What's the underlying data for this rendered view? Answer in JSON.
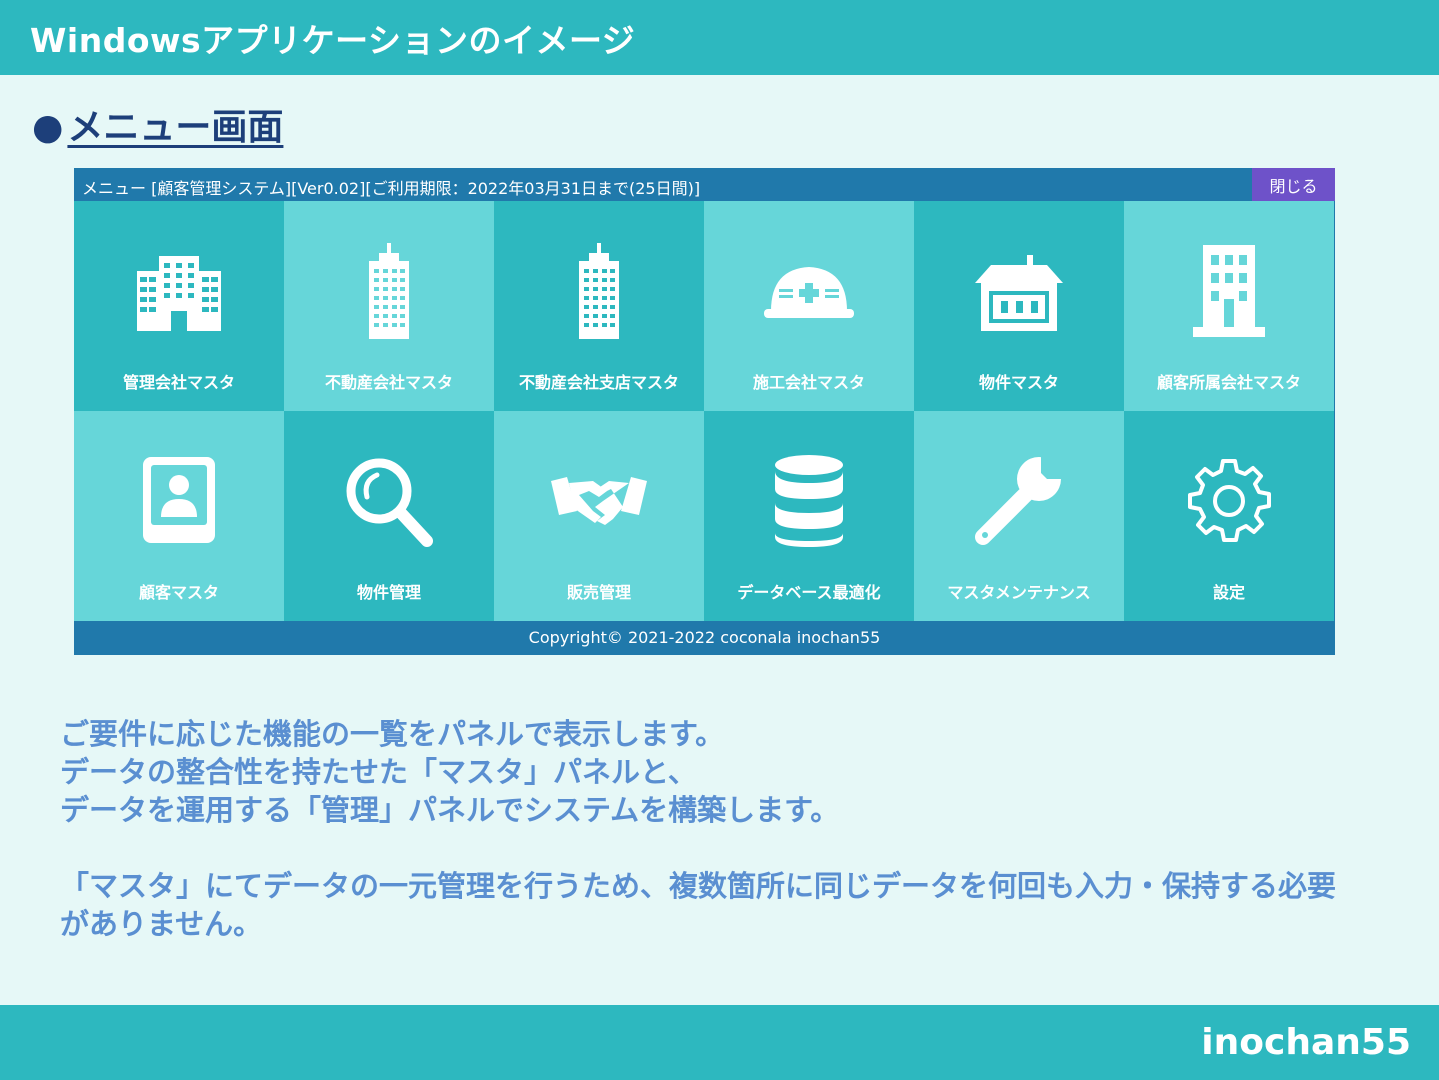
{
  "slide": {
    "title": "Windowsアプリケーションのイメージ",
    "bullet": "●",
    "heading": "メニュー画面",
    "author": "inochan55"
  },
  "app": {
    "window_title": "メニュー [顧客管理システム][Ver0.02][ご利用期限：2022年03月31日まで(25日間)]",
    "close_label": "閉じる",
    "footer": "Copyright© 2021-2022 coconala inochan55",
    "tiles": [
      {
        "label": "管理会社マスタ",
        "icon": "office-buildings-icon"
      },
      {
        "label": "不動産会社マスタ",
        "icon": "tower-building-icon"
      },
      {
        "label": "不動産会社支店マスタ",
        "icon": "tower-building-icon"
      },
      {
        "label": "施工会社マスタ",
        "icon": "hard-hat-icon"
      },
      {
        "label": "物件マスタ",
        "icon": "house-icon"
      },
      {
        "label": "顧客所属会社マスタ",
        "icon": "company-building-icon"
      },
      {
        "label": "顧客マスタ",
        "icon": "contact-card-icon"
      },
      {
        "label": "物件管理",
        "icon": "magnifier-icon"
      },
      {
        "label": "販売管理",
        "icon": "handshake-icon"
      },
      {
        "label": "データベース最適化",
        "icon": "database-icon"
      },
      {
        "label": "マスタメンテナンス",
        "icon": "wrench-icon"
      },
      {
        "label": "設定",
        "icon": "gear-icon"
      }
    ]
  },
  "description": {
    "lines": [
      "ご要件に応じた機能の一覧をパネルで表示します。",
      "データの整合性を持たせた「マスタ」パネルと、",
      "データを運用する「管理」パネルでシステムを構築します。"
    ],
    "paragraph2": "「マスタ」にてデータの一元管理を行うため、複数箇所に同じデータを何回も入力・保持する必要がありません。"
  },
  "colors": {
    "teal": "#2db8bf",
    "light_teal": "#66d6d9",
    "blue_bar": "#2079ab",
    "close_purple": "#6e52c9",
    "heading_navy": "#1d3f7a",
    "description_blue": "#5a8fd1",
    "background": "#e6f8f7"
  }
}
